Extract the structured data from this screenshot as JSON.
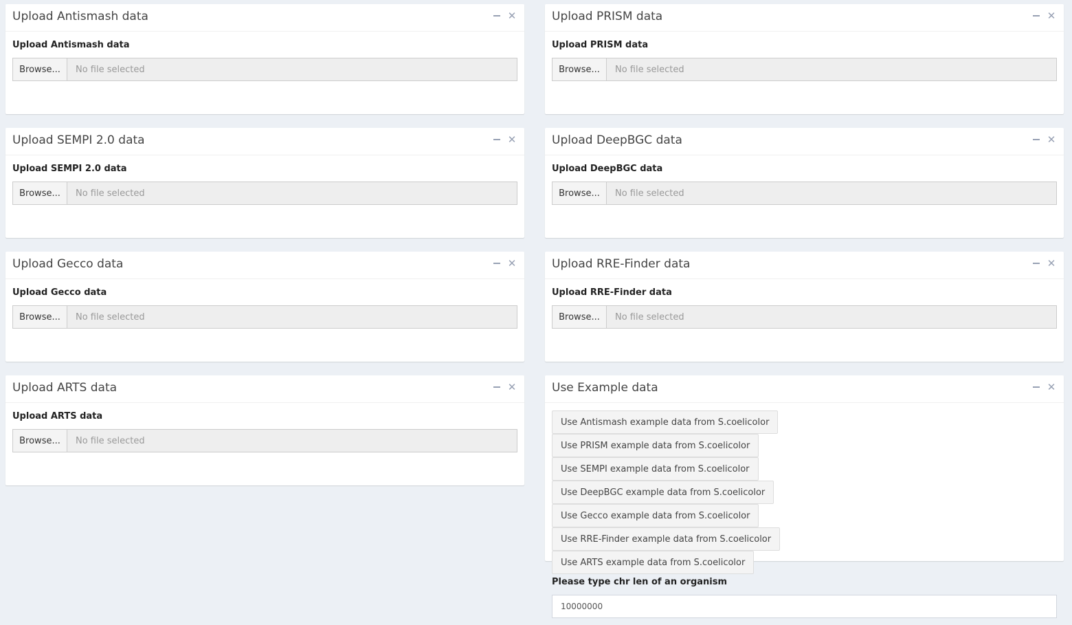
{
  "browse_label": "Browse...",
  "no_file_label": "No file selected",
  "left_boxes": [
    {
      "title": "Upload Antismash data",
      "label": "Upload Antismash data"
    },
    {
      "title": "Upload SEMPI 2.0 data",
      "label": "Upload SEMPI 2.0 data"
    },
    {
      "title": "Upload Gecco data",
      "label": "Upload Gecco data"
    },
    {
      "title": "Upload ARTS data",
      "label": "Upload ARTS data"
    }
  ],
  "right_boxes": [
    {
      "title": "Upload PRISM data",
      "label": "Upload PRISM data"
    },
    {
      "title": "Upload DeepBGC data",
      "label": "Upload DeepBGC data"
    },
    {
      "title": "Upload RRE-Finder data",
      "label": "Upload RRE-Finder data"
    }
  ],
  "example_box": {
    "title": "Use Example data",
    "buttons": [
      "Use Antismash example data from S.coelicolor",
      "Use PRISM example data from S.coelicolor",
      "Use SEMPI example data from S.coelicolor",
      "Use DeepBGC example data from S.coelicolor",
      "Use Gecco example data from S.coelicolor",
      "Use RRE-Finder example data from S.coelicolor",
      "Use ARTS example data from S.coelicolor"
    ],
    "chr_len_label": "Please type chr len of an organism",
    "chr_len_value": "10000000"
  },
  "icons": {
    "minimize": "minus-icon",
    "close": "close-icon"
  }
}
